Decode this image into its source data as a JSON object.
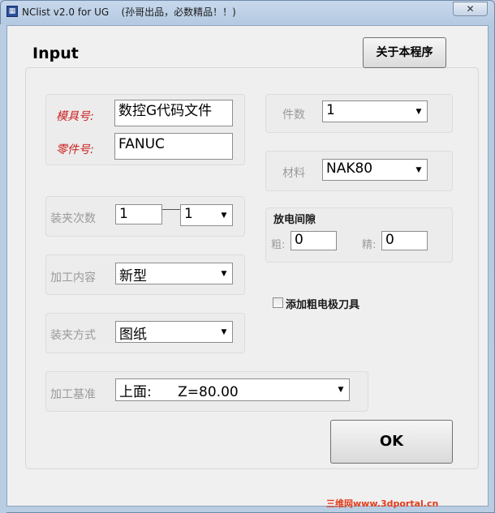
{
  "window": {
    "title": "NClist v2.0 for UG    (孙哥出品，必数精品！！)",
    "close_label": "✕"
  },
  "header": {
    "input_label": "Input",
    "about_button": "关于本程序"
  },
  "mold": {
    "mold_no_label": "模具号:",
    "mold_no_value": "数控G代码文件",
    "part_no_label": "零件号:",
    "part_no_value": "FANUC"
  },
  "quantity": {
    "label": "件数",
    "value": "1"
  },
  "material": {
    "label": "材料",
    "value": "NAK80"
  },
  "clamp_count": {
    "label": "装夹次数",
    "value_input": "1",
    "value_select": "1"
  },
  "edm_gap": {
    "title": "放电间隙",
    "rough_label": "粗:",
    "rough_value": "0",
    "fine_label": "精:",
    "fine_value": "0"
  },
  "process": {
    "label": "加工内容",
    "value": "新型"
  },
  "rough_electrode": {
    "label": "添加粗电极刀具",
    "checked": false
  },
  "clamp_method": {
    "label": "装夹方式",
    "value": "图纸"
  },
  "datum": {
    "label": "加工基准",
    "value": "上面:      Z=80.00"
  },
  "ok_button": "OK",
  "watermark": "三维网www.3dportal.cn",
  "icons": {
    "dropdown": "chevron-down-icon",
    "app": "app-icon"
  }
}
